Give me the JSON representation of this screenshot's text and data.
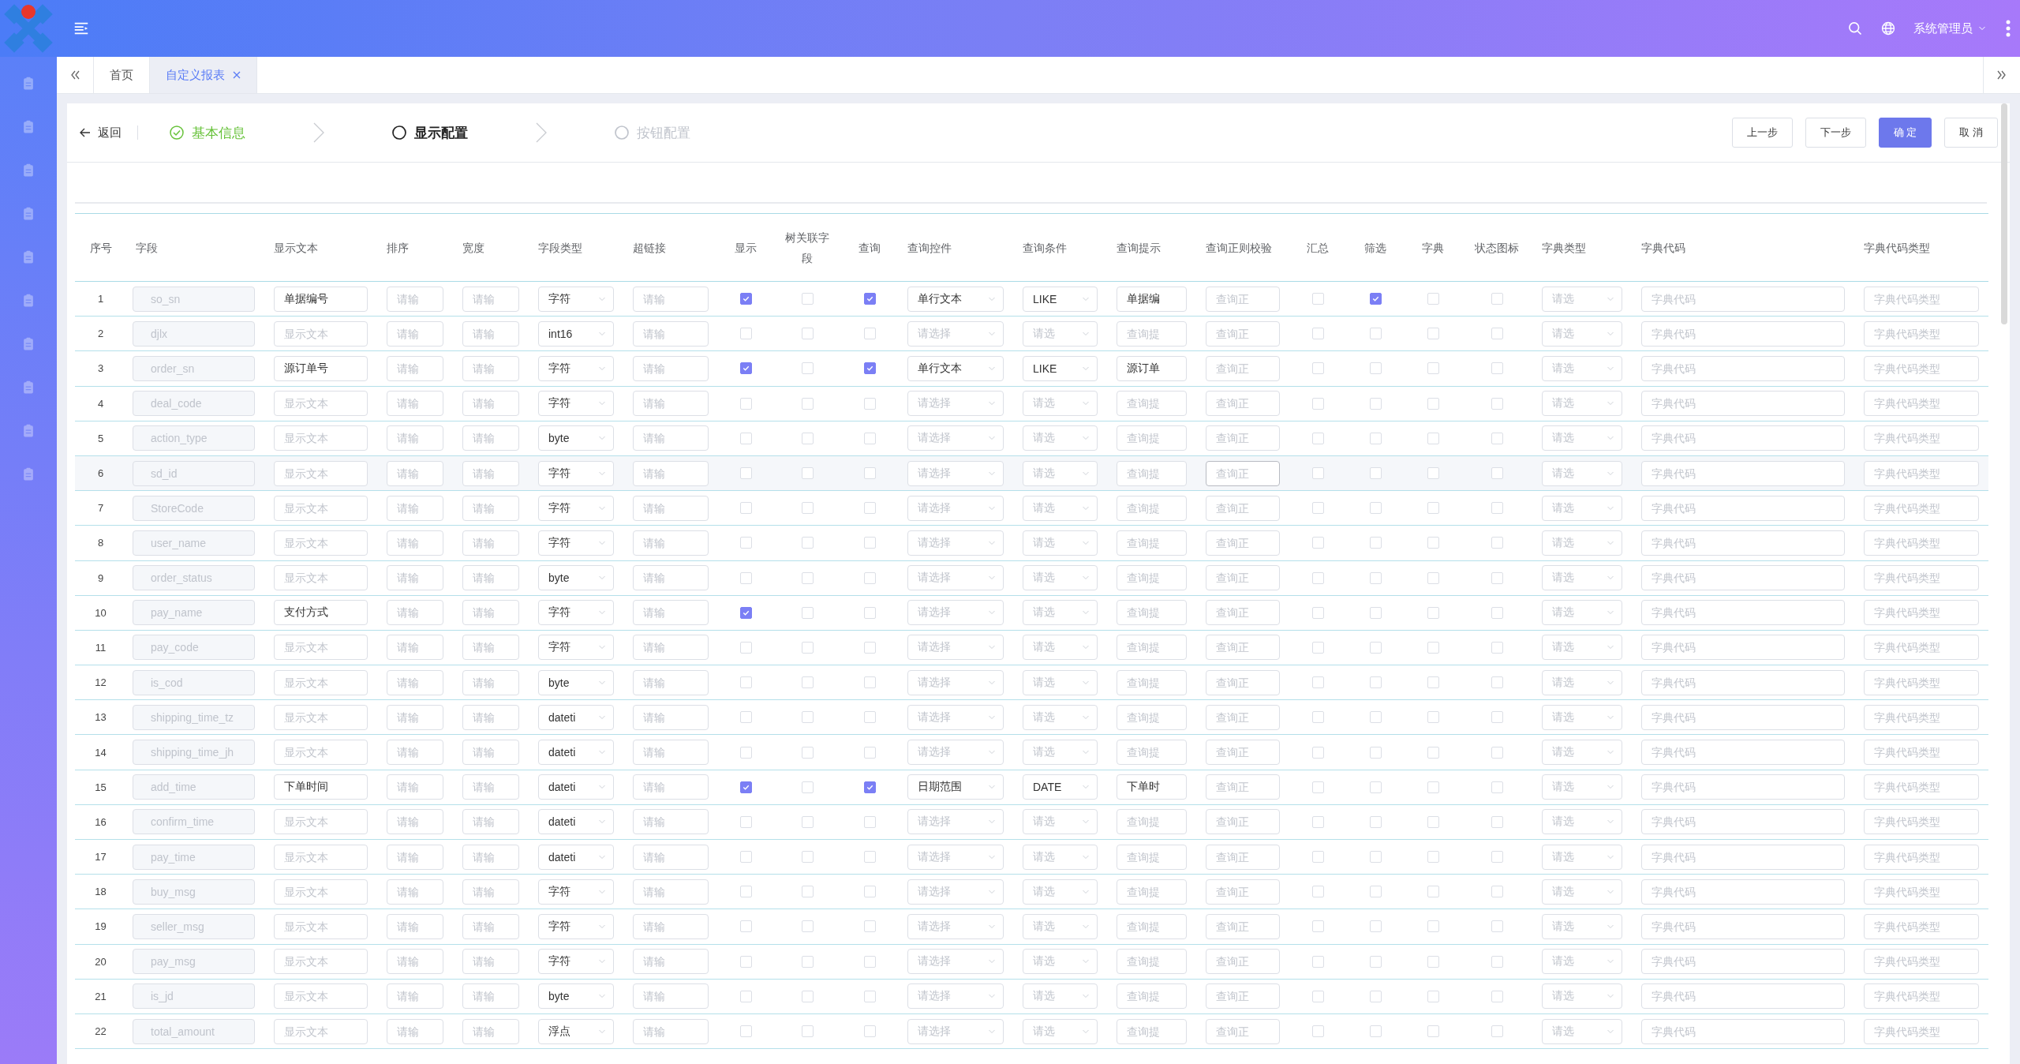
{
  "header": {
    "user": "系统管理员"
  },
  "tabs": [
    {
      "label": "首页",
      "selected": false,
      "closable": false
    },
    {
      "label": "自定义报表",
      "selected": true,
      "closable": true
    }
  ],
  "toolbar": {
    "back": "返回",
    "steps": [
      {
        "label": "基本信息",
        "completed": true,
        "selected": false
      },
      {
        "label": "显示配置",
        "completed": false,
        "selected": true
      },
      {
        "label": "按钮配置",
        "completed": false,
        "selected": false
      }
    ],
    "buttons": [
      {
        "label": "上一步",
        "disabled": false
      },
      {
        "label": "下一步",
        "disabled": false
      },
      {
        "label": "确 定",
        "disabled": true,
        "kind": "primary"
      },
      {
        "label": "取 消",
        "disabled": false
      }
    ]
  },
  "table": {
    "columns": [
      "序号",
      "字段",
      "显示文本",
      "排序",
      "宽度",
      "字段类型",
      "超链接",
      "显示",
      "树关联字段",
      "查询",
      "查询控件",
      "查询条件",
      "查询提示",
      "查询正则校验",
      "汇总",
      "筛选",
      "字典",
      "状态图标",
      "字典类型",
      "字典代码",
      "字典代码类型"
    ],
    "rows": [
      {
        "no": "1",
        "field": "so_sn",
        "display_text": {
          "value": "单据编号"
        },
        "sort": {
          "placeholder": "请输"
        },
        "width": {
          "placeholder": "请输"
        },
        "field_type": {
          "value": "字符"
        },
        "link": {
          "placeholder": "请输"
        },
        "show": true,
        "tree_field": false,
        "query": true,
        "query_control": {
          "value": "单行文本"
        },
        "query_condition": {
          "value": "LIKE"
        },
        "query_hint": {
          "value": "单据编"
        },
        "query_regex": {
          "placeholder": "查询正"
        },
        "summary": false,
        "filter": true,
        "dict": false,
        "status_icon": false,
        "dict_type": {
          "placeholder": "请选"
        },
        "dict_code": {
          "placeholder": "字典代码"
        },
        "dict_code_type": {
          "placeholder": "字典代码类型"
        },
        "hovered": false
      },
      {
        "no": "2",
        "field": "djlx",
        "display_text": {
          "placeholder": "显示文本"
        },
        "sort": {
          "placeholder": "请输"
        },
        "width": {
          "placeholder": "请输"
        },
        "field_type": {
          "value": "int16"
        },
        "link": {
          "placeholder": "请输"
        },
        "show": false,
        "tree_field": false,
        "query": false,
        "query_control": {
          "placeholder": "请选择"
        },
        "query_condition": {
          "placeholder": "请选"
        },
        "query_hint": {
          "placeholder": "查询提"
        },
        "query_regex": {
          "placeholder": "查询正"
        },
        "summary": false,
        "filter": false,
        "dict": false,
        "status_icon": false,
        "dict_type": {
          "placeholder": "请选"
        },
        "dict_code": {
          "placeholder": "字典代码"
        },
        "dict_code_type": {
          "placeholder": "字典代码类型"
        },
        "hovered": false
      },
      {
        "no": "3",
        "field": "order_sn",
        "display_text": {
          "value": "源订单号"
        },
        "sort": {
          "placeholder": "请输"
        },
        "width": {
          "placeholder": "请输"
        },
        "field_type": {
          "value": "字符"
        },
        "link": {
          "placeholder": "请输"
        },
        "show": true,
        "tree_field": false,
        "query": true,
        "query_control": {
          "value": "单行文本"
        },
        "query_condition": {
          "value": "LIKE"
        },
        "query_hint": {
          "value": "源订单"
        },
        "query_regex": {
          "placeholder": "查询正"
        },
        "summary": false,
        "filter": false,
        "dict": false,
        "status_icon": false,
        "dict_type": {
          "placeholder": "请选"
        },
        "dict_code": {
          "placeholder": "字典代码"
        },
        "dict_code_type": {
          "placeholder": "字典代码类型"
        },
        "hovered": false
      },
      {
        "no": "4",
        "field": "deal_code",
        "display_text": {
          "placeholder": "显示文本"
        },
        "sort": {
          "placeholder": "请输"
        },
        "width": {
          "placeholder": "请输"
        },
        "field_type": {
          "value": "字符"
        },
        "link": {
          "placeholder": "请输"
        },
        "show": false,
        "tree_field": false,
        "query": false,
        "query_control": {
          "placeholder": "请选择"
        },
        "query_condition": {
          "placeholder": "请选"
        },
        "query_hint": {
          "placeholder": "查询提"
        },
        "query_regex": {
          "placeholder": "查询正"
        },
        "summary": false,
        "filter": false,
        "dict": false,
        "status_icon": false,
        "dict_type": {
          "placeholder": "请选"
        },
        "dict_code": {
          "placeholder": "字典代码"
        },
        "dict_code_type": {
          "placeholder": "字典代码类型"
        },
        "hovered": false
      },
      {
        "no": "5",
        "field": "action_type",
        "display_text": {
          "placeholder": "显示文本"
        },
        "sort": {
          "placeholder": "请输"
        },
        "width": {
          "placeholder": "请输"
        },
        "field_type": {
          "value": "byte"
        },
        "link": {
          "placeholder": "请输"
        },
        "show": false,
        "tree_field": false,
        "query": false,
        "query_control": {
          "placeholder": "请选择"
        },
        "query_condition": {
          "placeholder": "请选"
        },
        "query_hint": {
          "placeholder": "查询提"
        },
        "query_regex": {
          "placeholder": "查询正"
        },
        "summary": false,
        "filter": false,
        "dict": false,
        "status_icon": false,
        "dict_type": {
          "placeholder": "请选"
        },
        "dict_code": {
          "placeholder": "字典代码"
        },
        "dict_code_type": {
          "placeholder": "字典代码类型"
        },
        "hovered": false
      },
      {
        "no": "6",
        "field": "sd_id",
        "display_text": {
          "placeholder": "显示文本"
        },
        "sort": {
          "placeholder": "请输"
        },
        "width": {
          "placeholder": "请输"
        },
        "field_type": {
          "value": "字符"
        },
        "link": {
          "placeholder": "请输"
        },
        "show": false,
        "tree_field": false,
        "query": false,
        "query_control": {
          "placeholder": "请选择"
        },
        "query_condition": {
          "placeholder": "请选"
        },
        "query_hint": {
          "placeholder": "查询提"
        },
        "query_regex": {
          "placeholder": "查询正"
        },
        "summary": false,
        "filter": false,
        "dict": false,
        "status_icon": false,
        "dict_type": {
          "placeholder": "请选"
        },
        "dict_code": {
          "placeholder": "字典代码"
        },
        "dict_code_type": {
          "placeholder": "字典代码类型"
        },
        "hovered": true
      },
      {
        "no": "7",
        "field": "StoreCode",
        "display_text": {
          "placeholder": "显示文本"
        },
        "sort": {
          "placeholder": "请输"
        },
        "width": {
          "placeholder": "请输"
        },
        "field_type": {
          "value": "字符"
        },
        "link": {
          "placeholder": "请输"
        },
        "show": false,
        "tree_field": false,
        "query": false,
        "query_control": {
          "placeholder": "请选择"
        },
        "query_condition": {
          "placeholder": "请选"
        },
        "query_hint": {
          "placeholder": "查询提"
        },
        "query_regex": {
          "placeholder": "查询正"
        },
        "summary": false,
        "filter": false,
        "dict": false,
        "status_icon": false,
        "dict_type": {
          "placeholder": "请选"
        },
        "dict_code": {
          "placeholder": "字典代码"
        },
        "dict_code_type": {
          "placeholder": "字典代码类型"
        },
        "hovered": false
      },
      {
        "no": "8",
        "field": "user_name",
        "display_text": {
          "placeholder": "显示文本"
        },
        "sort": {
          "placeholder": "请输"
        },
        "width": {
          "placeholder": "请输"
        },
        "field_type": {
          "value": "字符"
        },
        "link": {
          "placeholder": "请输"
        },
        "show": false,
        "tree_field": false,
        "query": false,
        "query_control": {
          "placeholder": "请选择"
        },
        "query_condition": {
          "placeholder": "请选"
        },
        "query_hint": {
          "placeholder": "查询提"
        },
        "query_regex": {
          "placeholder": "查询正"
        },
        "summary": false,
        "filter": false,
        "dict": false,
        "status_icon": false,
        "dict_type": {
          "placeholder": "请选"
        },
        "dict_code": {
          "placeholder": "字典代码"
        },
        "dict_code_type": {
          "placeholder": "字典代码类型"
        },
        "hovered": false
      },
      {
        "no": "9",
        "field": "order_status",
        "display_text": {
          "placeholder": "显示文本"
        },
        "sort": {
          "placeholder": "请输"
        },
        "width": {
          "placeholder": "请输"
        },
        "field_type": {
          "value": "byte"
        },
        "link": {
          "placeholder": "请输"
        },
        "show": false,
        "tree_field": false,
        "query": false,
        "query_control": {
          "placeholder": "请选择"
        },
        "query_condition": {
          "placeholder": "请选"
        },
        "query_hint": {
          "placeholder": "查询提"
        },
        "query_regex": {
          "placeholder": "查询正"
        },
        "summary": false,
        "filter": false,
        "dict": false,
        "status_icon": false,
        "dict_type": {
          "placeholder": "请选"
        },
        "dict_code": {
          "placeholder": "字典代码"
        },
        "dict_code_type": {
          "placeholder": "字典代码类型"
        },
        "hovered": false
      },
      {
        "no": "10",
        "field": "pay_name",
        "display_text": {
          "value": "支付方式"
        },
        "sort": {
          "placeholder": "请输"
        },
        "width": {
          "placeholder": "请输"
        },
        "field_type": {
          "value": "字符"
        },
        "link": {
          "placeholder": "请输"
        },
        "show": true,
        "tree_field": false,
        "query": false,
        "query_control": {
          "placeholder": "请选择"
        },
        "query_condition": {
          "placeholder": "请选"
        },
        "query_hint": {
          "placeholder": "查询提"
        },
        "query_regex": {
          "placeholder": "查询正"
        },
        "summary": false,
        "filter": false,
        "dict": false,
        "status_icon": false,
        "dict_type": {
          "placeholder": "请选"
        },
        "dict_code": {
          "placeholder": "字典代码"
        },
        "dict_code_type": {
          "placeholder": "字典代码类型"
        },
        "hovered": false
      },
      {
        "no": "11",
        "field": "pay_code",
        "display_text": {
          "placeholder": "显示文本"
        },
        "sort": {
          "placeholder": "请输"
        },
        "width": {
          "placeholder": "请输"
        },
        "field_type": {
          "value": "字符"
        },
        "link": {
          "placeholder": "请输"
        },
        "show": false,
        "tree_field": false,
        "query": false,
        "query_control": {
          "placeholder": "请选择"
        },
        "query_condition": {
          "placeholder": "请选"
        },
        "query_hint": {
          "placeholder": "查询提"
        },
        "query_regex": {
          "placeholder": "查询正"
        },
        "summary": false,
        "filter": false,
        "dict": false,
        "status_icon": false,
        "dict_type": {
          "placeholder": "请选"
        },
        "dict_code": {
          "placeholder": "字典代码"
        },
        "dict_code_type": {
          "placeholder": "字典代码类型"
        },
        "hovered": false
      },
      {
        "no": "12",
        "field": "is_cod",
        "display_text": {
          "placeholder": "显示文本"
        },
        "sort": {
          "placeholder": "请输"
        },
        "width": {
          "placeholder": "请输"
        },
        "field_type": {
          "value": "byte"
        },
        "link": {
          "placeholder": "请输"
        },
        "show": false,
        "tree_field": false,
        "query": false,
        "query_control": {
          "placeholder": "请选择"
        },
        "query_condition": {
          "placeholder": "请选"
        },
        "query_hint": {
          "placeholder": "查询提"
        },
        "query_regex": {
          "placeholder": "查询正"
        },
        "summary": false,
        "filter": false,
        "dict": false,
        "status_icon": false,
        "dict_type": {
          "placeholder": "请选"
        },
        "dict_code": {
          "placeholder": "字典代码"
        },
        "dict_code_type": {
          "placeholder": "字典代码类型"
        },
        "hovered": false
      },
      {
        "no": "13",
        "field": "shipping_time_tz",
        "display_text": {
          "placeholder": "显示文本"
        },
        "sort": {
          "placeholder": "请输"
        },
        "width": {
          "placeholder": "请输"
        },
        "field_type": {
          "value": "dateti"
        },
        "link": {
          "placeholder": "请输"
        },
        "show": false,
        "tree_field": false,
        "query": false,
        "query_control": {
          "placeholder": "请选择"
        },
        "query_condition": {
          "placeholder": "请选"
        },
        "query_hint": {
          "placeholder": "查询提"
        },
        "query_regex": {
          "placeholder": "查询正"
        },
        "summary": false,
        "filter": false,
        "dict": false,
        "status_icon": false,
        "dict_type": {
          "placeholder": "请选"
        },
        "dict_code": {
          "placeholder": "字典代码"
        },
        "dict_code_type": {
          "placeholder": "字典代码类型"
        },
        "hovered": false
      },
      {
        "no": "14",
        "field": "shipping_time_jh",
        "display_text": {
          "placeholder": "显示文本"
        },
        "sort": {
          "placeholder": "请输"
        },
        "width": {
          "placeholder": "请输"
        },
        "field_type": {
          "value": "dateti"
        },
        "link": {
          "placeholder": "请输"
        },
        "show": false,
        "tree_field": false,
        "query": false,
        "query_control": {
          "placeholder": "请选择"
        },
        "query_condition": {
          "placeholder": "请选"
        },
        "query_hint": {
          "placeholder": "查询提"
        },
        "query_regex": {
          "placeholder": "查询正"
        },
        "summary": false,
        "filter": false,
        "dict": false,
        "status_icon": false,
        "dict_type": {
          "placeholder": "请选"
        },
        "dict_code": {
          "placeholder": "字典代码"
        },
        "dict_code_type": {
          "placeholder": "字典代码类型"
        },
        "hovered": false
      },
      {
        "no": "15",
        "field": "add_time",
        "display_text": {
          "value": "下单时间"
        },
        "sort": {
          "placeholder": "请输"
        },
        "width": {
          "placeholder": "请输"
        },
        "field_type": {
          "value": "dateti"
        },
        "link": {
          "placeholder": "请输"
        },
        "show": true,
        "tree_field": false,
        "query": true,
        "query_control": {
          "value": "日期范围"
        },
        "query_condition": {
          "value": "DATE"
        },
        "query_hint": {
          "value": "下单时"
        },
        "query_regex": {
          "placeholder": "查询正"
        },
        "summary": false,
        "filter": false,
        "dict": false,
        "status_icon": false,
        "dict_type": {
          "placeholder": "请选"
        },
        "dict_code": {
          "placeholder": "字典代码"
        },
        "dict_code_type": {
          "placeholder": "字典代码类型"
        },
        "hovered": false
      },
      {
        "no": "16",
        "field": "confirm_time",
        "display_text": {
          "placeholder": "显示文本"
        },
        "sort": {
          "placeholder": "请输"
        },
        "width": {
          "placeholder": "请输"
        },
        "field_type": {
          "value": "dateti"
        },
        "link": {
          "placeholder": "请输"
        },
        "show": false,
        "tree_field": false,
        "query": false,
        "query_control": {
          "placeholder": "请选择"
        },
        "query_condition": {
          "placeholder": "请选"
        },
        "query_hint": {
          "placeholder": "查询提"
        },
        "query_regex": {
          "placeholder": "查询正"
        },
        "summary": false,
        "filter": false,
        "dict": false,
        "status_icon": false,
        "dict_type": {
          "placeholder": "请选"
        },
        "dict_code": {
          "placeholder": "字典代码"
        },
        "dict_code_type": {
          "placeholder": "字典代码类型"
        },
        "hovered": false
      },
      {
        "no": "17",
        "field": "pay_time",
        "display_text": {
          "placeholder": "显示文本"
        },
        "sort": {
          "placeholder": "请输"
        },
        "width": {
          "placeholder": "请输"
        },
        "field_type": {
          "value": "dateti"
        },
        "link": {
          "placeholder": "请输"
        },
        "show": false,
        "tree_field": false,
        "query": false,
        "query_control": {
          "placeholder": "请选择"
        },
        "query_condition": {
          "placeholder": "请选"
        },
        "query_hint": {
          "placeholder": "查询提"
        },
        "query_regex": {
          "placeholder": "查询正"
        },
        "summary": false,
        "filter": false,
        "dict": false,
        "status_icon": false,
        "dict_type": {
          "placeholder": "请选"
        },
        "dict_code": {
          "placeholder": "字典代码"
        },
        "dict_code_type": {
          "placeholder": "字典代码类型"
        },
        "hovered": false
      },
      {
        "no": "18",
        "field": "buy_msg",
        "display_text": {
          "placeholder": "显示文本"
        },
        "sort": {
          "placeholder": "请输"
        },
        "width": {
          "placeholder": "请输"
        },
        "field_type": {
          "value": "字符"
        },
        "link": {
          "placeholder": "请输"
        },
        "show": false,
        "tree_field": false,
        "query": false,
        "query_control": {
          "placeholder": "请选择"
        },
        "query_condition": {
          "placeholder": "请选"
        },
        "query_hint": {
          "placeholder": "查询提"
        },
        "query_regex": {
          "placeholder": "查询正"
        },
        "summary": false,
        "filter": false,
        "dict": false,
        "status_icon": false,
        "dict_type": {
          "placeholder": "请选"
        },
        "dict_code": {
          "placeholder": "字典代码"
        },
        "dict_code_type": {
          "placeholder": "字典代码类型"
        },
        "hovered": false
      },
      {
        "no": "19",
        "field": "seller_msg",
        "display_text": {
          "placeholder": "显示文本"
        },
        "sort": {
          "placeholder": "请输"
        },
        "width": {
          "placeholder": "请输"
        },
        "field_type": {
          "value": "字符"
        },
        "link": {
          "placeholder": "请输"
        },
        "show": false,
        "tree_field": false,
        "query": false,
        "query_control": {
          "placeholder": "请选择"
        },
        "query_condition": {
          "placeholder": "请选"
        },
        "query_hint": {
          "placeholder": "查询提"
        },
        "query_regex": {
          "placeholder": "查询正"
        },
        "summary": false,
        "filter": false,
        "dict": false,
        "status_icon": false,
        "dict_type": {
          "placeholder": "请选"
        },
        "dict_code": {
          "placeholder": "字典代码"
        },
        "dict_code_type": {
          "placeholder": "字典代码类型"
        },
        "hovered": false
      },
      {
        "no": "20",
        "field": "pay_msg",
        "display_text": {
          "placeholder": "显示文本"
        },
        "sort": {
          "placeholder": "请输"
        },
        "width": {
          "placeholder": "请输"
        },
        "field_type": {
          "value": "字符"
        },
        "link": {
          "placeholder": "请输"
        },
        "show": false,
        "tree_field": false,
        "query": false,
        "query_control": {
          "placeholder": "请选择"
        },
        "query_condition": {
          "placeholder": "请选"
        },
        "query_hint": {
          "placeholder": "查询提"
        },
        "query_regex": {
          "placeholder": "查询正"
        },
        "summary": false,
        "filter": false,
        "dict": false,
        "status_icon": false,
        "dict_type": {
          "placeholder": "请选"
        },
        "dict_code": {
          "placeholder": "字典代码"
        },
        "dict_code_type": {
          "placeholder": "字典代码类型"
        },
        "hovered": false
      },
      {
        "no": "21",
        "field": "is_jd",
        "display_text": {
          "placeholder": "显示文本"
        },
        "sort": {
          "placeholder": "请输"
        },
        "width": {
          "placeholder": "请输"
        },
        "field_type": {
          "value": "byte"
        },
        "link": {
          "placeholder": "请输"
        },
        "show": false,
        "tree_field": false,
        "query": false,
        "query_control": {
          "placeholder": "请选择"
        },
        "query_condition": {
          "placeholder": "请选"
        },
        "query_hint": {
          "placeholder": "查询提"
        },
        "query_regex": {
          "placeholder": "查询正"
        },
        "summary": false,
        "filter": false,
        "dict": false,
        "status_icon": false,
        "dict_type": {
          "placeholder": "请选"
        },
        "dict_code": {
          "placeholder": "字典代码"
        },
        "dict_code_type": {
          "placeholder": "字典代码类型"
        },
        "hovered": false
      },
      {
        "no": "22",
        "field": "total_amount",
        "display_text": {
          "placeholder": "显示文本"
        },
        "sort": {
          "placeholder": "请输"
        },
        "width": {
          "placeholder": "请输"
        },
        "field_type": {
          "value": "浮点"
        },
        "link": {
          "placeholder": "请输"
        },
        "show": false,
        "tree_field": false,
        "query": false,
        "query_control": {
          "placeholder": "请选择"
        },
        "query_condition": {
          "placeholder": "请选"
        },
        "query_hint": {
          "placeholder": "查询提"
        },
        "query_regex": {
          "placeholder": "查询正"
        },
        "summary": false,
        "filter": false,
        "dict": false,
        "status_icon": false,
        "dict_type": {
          "placeholder": "请选"
        },
        "dict_code": {
          "placeholder": "字典代码"
        },
        "dict_code_type": {
          "placeholder": "字典代码类型"
        },
        "hovered": false
      }
    ]
  }
}
